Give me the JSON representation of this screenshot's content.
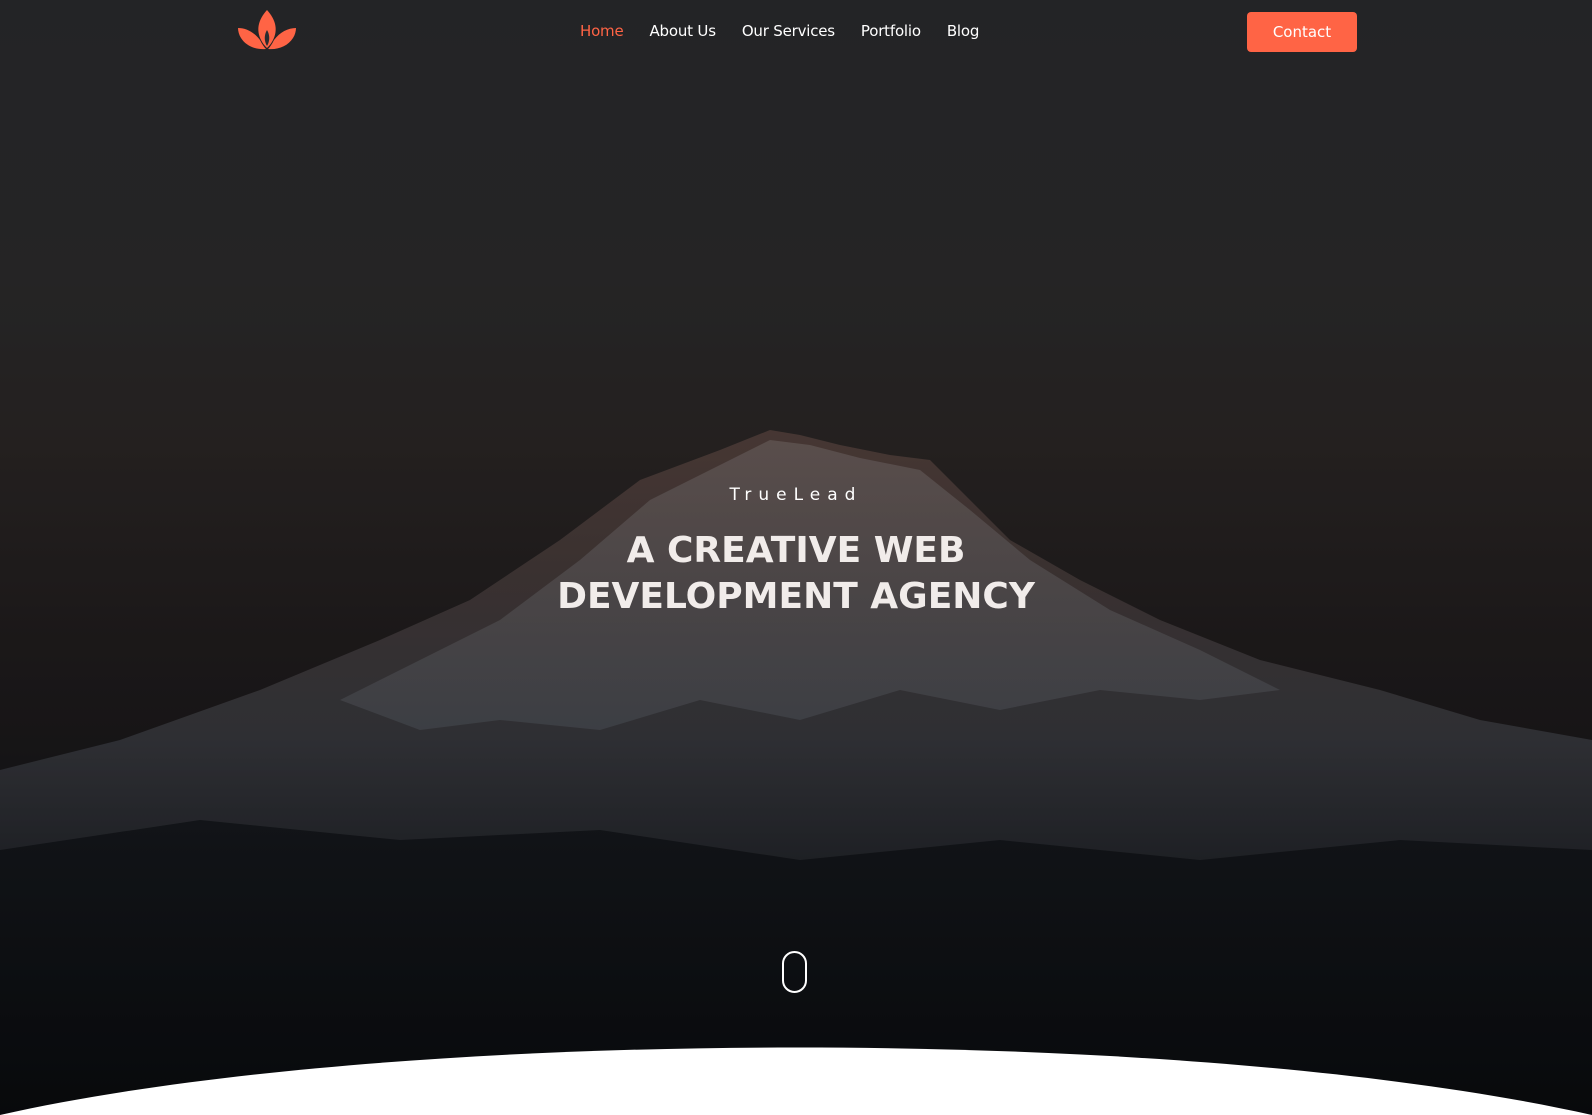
{
  "header": {
    "logo_icon": "lotus-flame-logo-icon",
    "nav": [
      {
        "label": "Home",
        "active": true
      },
      {
        "label": "About Us",
        "active": false
      },
      {
        "label": "Our Services",
        "active": false
      },
      {
        "label": "Portfolio",
        "active": false
      },
      {
        "label": "Blog",
        "active": false
      }
    ],
    "contact_label": "Contact"
  },
  "hero": {
    "eyebrow": "TrueLead",
    "headline_line1": "A CREATIVE WEB",
    "headline_line2": "DEVELOPMENT AGENCY",
    "background": "mountain-at-dusk-image",
    "scroll_icon": "mouse-scroll-icon"
  },
  "colors": {
    "accent": "#ff6445",
    "text_light": "#ffffff",
    "background_dark": "#2b2c2f"
  }
}
